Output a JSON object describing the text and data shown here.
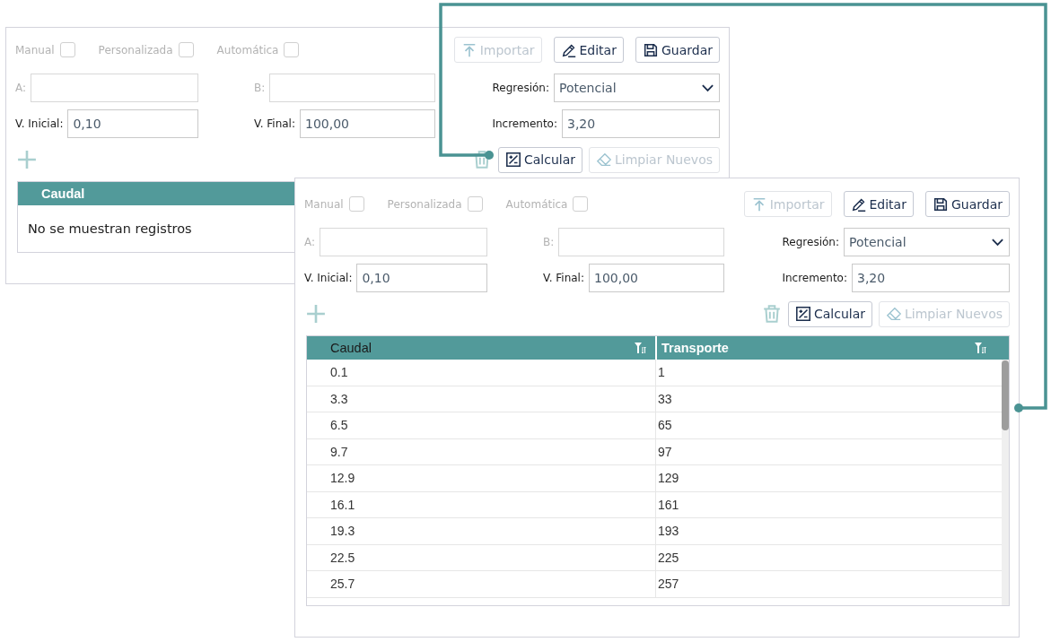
{
  "panels": [
    {
      "checkboxes": [
        {
          "label": "Manual",
          "checked": false
        },
        {
          "label": "Personalizada",
          "checked": false
        },
        {
          "label": "Automática",
          "checked": false
        }
      ],
      "top_buttons": [
        {
          "kind": "import",
          "label": "Importar",
          "disabled": true
        },
        {
          "kind": "edit",
          "label": "Editar",
          "disabled": false
        },
        {
          "kind": "save",
          "label": "Guardar",
          "disabled": false
        }
      ],
      "fields": [
        {
          "kind": "text",
          "label": "A:",
          "disabled": true
        },
        {
          "kind": "text",
          "label": "B:",
          "disabled": true
        },
        {
          "kind": "select",
          "label": "Regresión:",
          "value": "Potencial",
          "disabled": false
        },
        {
          "kind": "text",
          "label": "V. Inicial:",
          "value": "0,10",
          "disabled": false
        },
        {
          "kind": "text",
          "label": "V. Final:",
          "value": "100,00",
          "disabled": false
        },
        {
          "kind": "text",
          "label": "Incremento:",
          "value": "3,20",
          "disabled": false
        }
      ],
      "actions": [
        {
          "kind": "add",
          "disabled": true
        },
        {
          "kind": "delete",
          "disabled": true
        },
        {
          "kind": "calculate",
          "label": "Calcular",
          "disabled": false
        },
        {
          "kind": "clear",
          "label": "Limpiar Nuevos",
          "disabled": true
        }
      ],
      "table": {
        "columns": [
          {
            "label": "Caudal",
            "filterable": false
          }
        ],
        "empty_message": "No se muestran registros"
      }
    },
    {
      "checkboxes": [
        {
          "label": "Manual",
          "checked": false
        },
        {
          "label": "Personalizada",
          "checked": false
        },
        {
          "label": "Automática",
          "checked": false
        }
      ],
      "top_buttons": [
        {
          "kind": "import",
          "label": "Importar",
          "disabled": true
        },
        {
          "kind": "edit",
          "label": "Editar",
          "disabled": false
        },
        {
          "kind": "save",
          "label": "Guardar",
          "disabled": false
        }
      ],
      "fields": [
        {
          "kind": "text",
          "label": "A:",
          "disabled": true
        },
        {
          "kind": "text",
          "label": "B:",
          "disabled": true
        },
        {
          "kind": "select",
          "label": "Regresión:",
          "value": "Potencial",
          "disabled": false
        },
        {
          "kind": "text",
          "label": "V. Inicial:",
          "value": "0,10",
          "disabled": false
        },
        {
          "kind": "text",
          "label": "V. Final:",
          "value": "100,00",
          "disabled": false
        },
        {
          "kind": "text",
          "label": "Incremento:",
          "value": "3,20",
          "disabled": false
        }
      ],
      "actions": [
        {
          "kind": "add",
          "disabled": true
        },
        {
          "kind": "delete",
          "disabled": true
        },
        {
          "kind": "calculate",
          "label": "Calcular",
          "disabled": false
        },
        {
          "kind": "clear",
          "label": "Limpiar Nuevos",
          "disabled": true
        }
      ],
      "table": {
        "columns": [
          {
            "label": "Caudal",
            "filterable": true
          },
          {
            "label": "Transporte",
            "filterable": true
          }
        ],
        "rows": [
          [
            "0.1",
            "1"
          ],
          [
            "3.3",
            "33"
          ],
          [
            "6.5",
            "65"
          ],
          [
            "9.7",
            "97"
          ],
          [
            "12.9",
            "129"
          ],
          [
            "16.1",
            "161"
          ],
          [
            "19.3",
            "193"
          ],
          [
            "22.5",
            "225"
          ],
          [
            "25.7",
            "257"
          ]
        ]
      }
    }
  ]
}
